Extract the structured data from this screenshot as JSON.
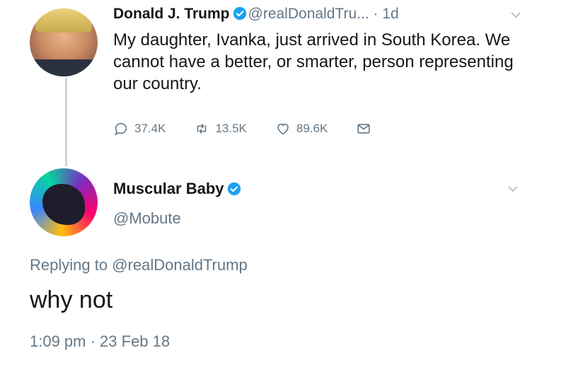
{
  "original_tweet": {
    "display_name": "Donald J. Trump",
    "handle": "@realDonaldTru...",
    "age": "· 1d",
    "text": "My daughter, Ivanka, just arrived in South Korea. We cannot have a better, or smarter, person representing our country.",
    "actions": {
      "replies": "37.4K",
      "retweets": "13.5K",
      "likes": "89.6K"
    }
  },
  "reply_tweet": {
    "display_name": "Muscular Baby",
    "handle": "@Mobute",
    "replying_prefix": "Replying to",
    "replying_to": "@realDonaldTrump",
    "text": "why not",
    "timestamp": "1:09 pm · 23 Feb 18"
  },
  "colors": {
    "verified_blue": "#1da1f2",
    "muted_gray": "#657786",
    "thread_line": "#ccd6dd"
  }
}
